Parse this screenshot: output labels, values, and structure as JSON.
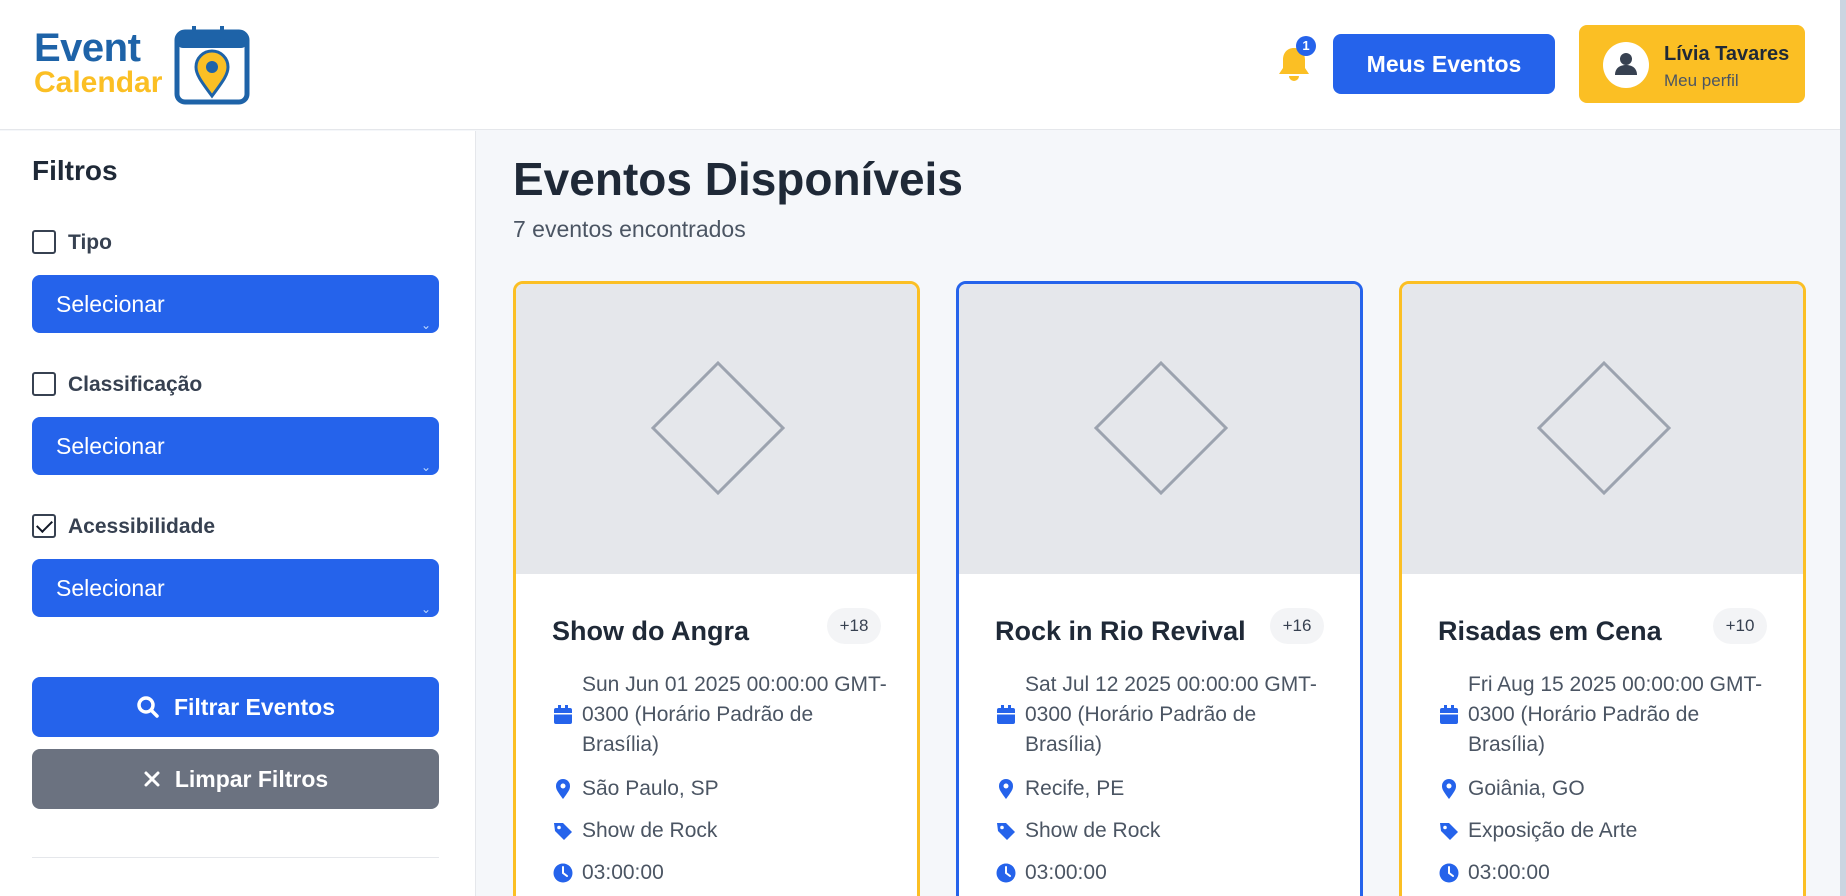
{
  "header": {
    "logo_word1": "Event",
    "logo_word2": "Calendar",
    "notification_count": "1",
    "my_events_button": "Meus Eventos",
    "profile": {
      "name": "Lívia Tavares",
      "subtitle": "Meu perfil"
    }
  },
  "sidebar": {
    "title": "Filtros",
    "filters": [
      {
        "label": "Tipo",
        "checked": false,
        "select_value": "Selecionar"
      },
      {
        "label": "Classificação",
        "checked": false,
        "select_value": "Selecionar"
      },
      {
        "label": "Acessibilidade",
        "checked": true,
        "select_value": "Selecionar"
      }
    ],
    "filter_button": "Filtrar Eventos",
    "clear_button": "Limpar Filtros"
  },
  "main": {
    "title": "Eventos Disponíveis",
    "count_text": "7 eventos encontrados",
    "events": [
      {
        "title": "Show do Angra",
        "age": "+18",
        "date": "Sun Jun 01 2025 00:00:00 GMT-0300 (Horário Padrão de Brasília)",
        "location": "São Paulo, SP",
        "category": "Show de Rock",
        "time": "03:00:00",
        "border_color": "#fbbf24"
      },
      {
        "title": "Rock in Rio Revival",
        "age": "+16",
        "date": "Sat Jul 12 2025 00:00:00 GMT-0300 (Horário Padrão de Brasília)",
        "location": "Recife, PE",
        "category": "Show de Rock",
        "time": "03:00:00",
        "border_color": "#2563eb"
      },
      {
        "title": "Risadas em Cena",
        "age": "+10",
        "date": "Fri Aug 15 2025 00:00:00 GMT-0300 (Horário Padrão de Brasília)",
        "location": "Goiânia, GO",
        "category": "Exposição de Arte",
        "time": "03:00:00",
        "border_color": "#fbbf24"
      }
    ]
  },
  "colors": {
    "primary": "#2563eb",
    "accent": "#fbbf24",
    "logo_blue": "#1e63a8",
    "secondary_button": "#6b7280"
  }
}
